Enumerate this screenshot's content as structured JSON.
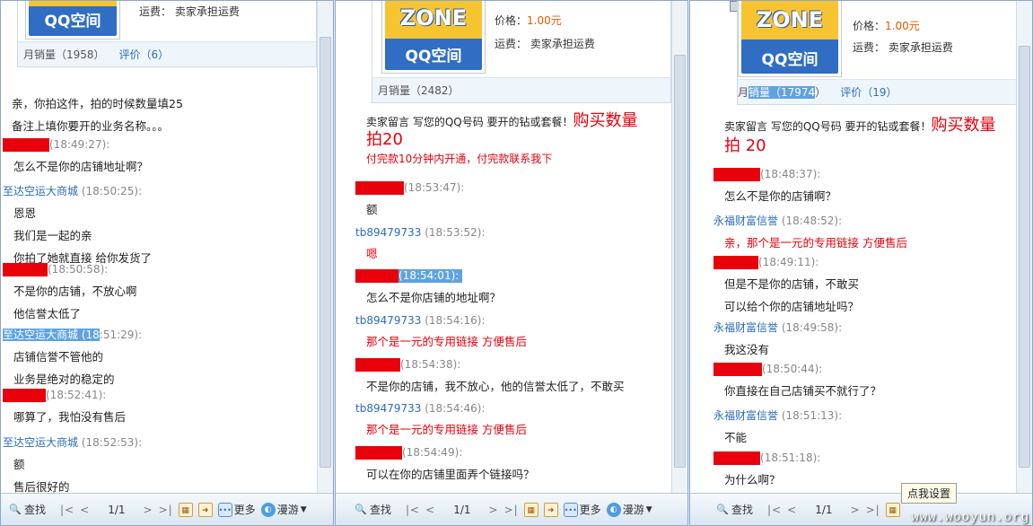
{
  "toolbar": {
    "search": "查找",
    "page": "1/1",
    "more": "更多",
    "roam": "漫游"
  },
  "tooltip": "点我设置",
  "watermark": "www.wooyun.org",
  "panel1": {
    "product": {
      "shipping": "运费：  卖家承担运费",
      "sales": "月销量（1958）",
      "rating": "评价（6）"
    },
    "intro": [
      "亲，你拍这件，拍的时候数量填25",
      "备注上填你要开的业务名称。。。"
    ],
    "messages": [
      {
        "sender": "",
        "time": "(18:49:27):",
        "lines": [
          "怎么不是你的店铺地址啊？"
        ]
      },
      {
        "sender": "至达空运大商城",
        "time": "(18:50:25):",
        "lines": [
          "恩恩",
          "我们是一起的亲",
          "你拍了她就直接 给你发货了"
        ]
      },
      {
        "sender": "",
        "time": "(18:50:58):",
        "lines": [
          "不是你的店铺，不放心啊",
          "他信誉太低了"
        ]
      },
      {
        "sender_sel": "至达空运大商城 (18",
        "time": ":51:29):",
        "lines": [
          "店铺信誉不管他的",
          "业务是绝对的稳定的"
        ]
      },
      {
        "sender": "",
        "time": "(18:52:41):",
        "lines": [
          "哪算了，我怕没有售后"
        ]
      },
      {
        "sender": "至达空运大商城",
        "time": "(18:52:53):",
        "lines": [
          "额",
          "售后很好的"
        ]
      }
    ]
  },
  "panel2": {
    "product": {
      "price_label": "价格：",
      "price": "1.00元",
      "shipping": "运费：  卖家承担运费",
      "sales": "月销量（2482）",
      "logo_top": "ZONE",
      "logo_bottom": "QQ空间"
    },
    "notice": "卖家留言 写您的QQ号码  要开的钻或套餐！",
    "notice_big": "购买数量",
    "notice_big2": "拍20",
    "notice_red": "付完款10分钟内开通，付完款联系我下",
    "messages": [
      {
        "sender": "",
        "time": "(18:53:47):",
        "lines": [
          "额"
        ]
      },
      {
        "sender": "tb89479733",
        "time": "(18:53:52):",
        "lines": [
          "嗯"
        ],
        "red": true
      },
      {
        "sender": "",
        "time": "(18:54:01):",
        "lines": [
          "怎么不是你店铺的地址啊？"
        ],
        "selected": true
      },
      {
        "sender": "tb89479733",
        "time": "(18:54:16):",
        "lines": [
          "那个是一元的专用链接  方便售后"
        ],
        "red": true
      },
      {
        "sender": "",
        "time": "(18:54:38):",
        "lines": [
          "不是你的店铺，我不放心，他的信誉太低了，不敢买"
        ]
      },
      {
        "sender": "tb89479733",
        "time": "(18:54:46):",
        "lines": [
          "那个是一元的专用链接  方便售后"
        ],
        "red": true
      },
      {
        "sender": "",
        "time": "(18:54:49):",
        "lines": [
          "可以在你的店铺里面弄个链接吗？"
        ]
      }
    ]
  },
  "panel3": {
    "product": {
      "price_label": "价格：",
      "price": "1.00元",
      "shipping": "运费：  卖家承担运费",
      "sales_a": "月",
      "sales_b": "销量（17974",
      "sales_c": "）",
      "rating": "评价（19）",
      "logo_top": "ZONE",
      "logo_bottom": "QQ空间"
    },
    "notice": "卖家留言 写您的QQ号码  要开的钻或套餐！",
    "notice_big": "购买数量",
    "notice_big2": "拍 20",
    "messages": [
      {
        "sender": "",
        "time": "(18:48:37):",
        "lines": [
          "怎么不是你的店铺啊？"
        ]
      },
      {
        "sender": "永福财富信誉",
        "time": "(18:48:52):",
        "lines": [
          "亲，那个是一元的专用链接  方便售后"
        ],
        "red": true
      },
      {
        "sender": "",
        "time": "(18:49:11):",
        "lines": [
          "但是不是你的店铺，不敢买",
          "可以给个你的店铺地址吗？"
        ]
      },
      {
        "sender": "永福财富信誉",
        "time": "(18:49:58):",
        "lines": [
          "我这没有"
        ]
      },
      {
        "sender": "",
        "time": "(18:50:44):",
        "lines": [
          "你直接在自己店铺买不就行了？"
        ]
      },
      {
        "sender": "永福财富信誉",
        "time": "(18:51:13):",
        "lines": [
          "不能"
        ]
      },
      {
        "sender": "",
        "time": "(18:51:18):",
        "lines": [
          "为什么啊？"
        ]
      }
    ]
  }
}
